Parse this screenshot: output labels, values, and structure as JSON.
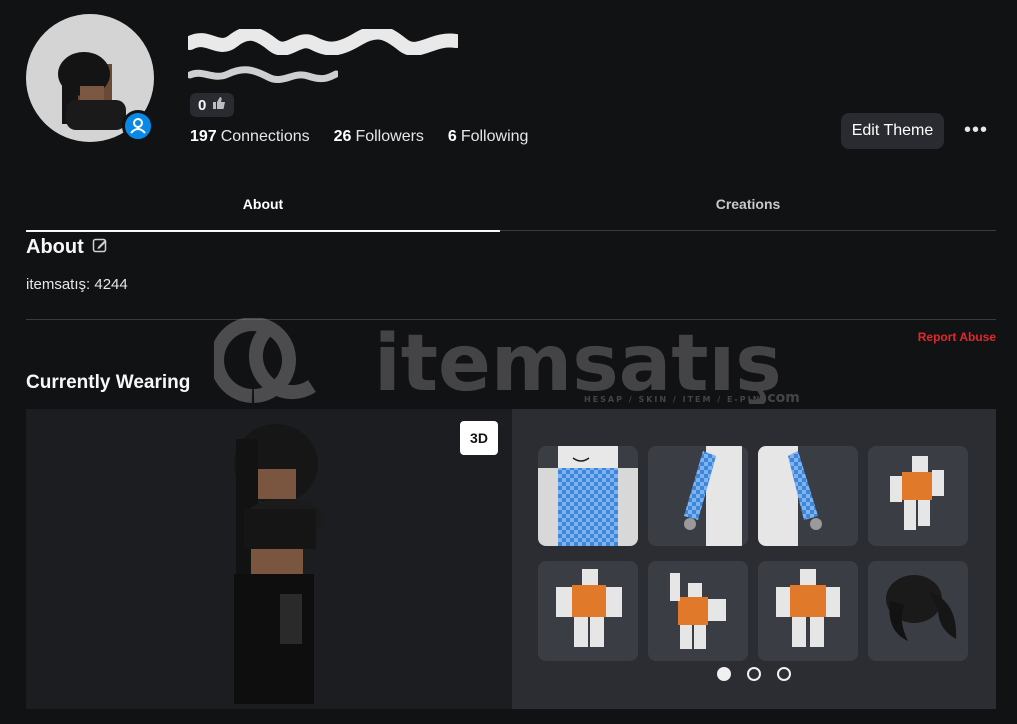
{
  "profile": {
    "likes": "0",
    "stats": [
      {
        "count": "197",
        "label": "Connections"
      },
      {
        "count": "26",
        "label": "Followers"
      },
      {
        "count": "6",
        "label": "Following"
      }
    ],
    "edit_theme_label": "Edit Theme",
    "more_label": "•••"
  },
  "tabs": [
    {
      "label": "About",
      "active": true
    },
    {
      "label": "Creations",
      "active": false
    }
  ],
  "about": {
    "title": "About",
    "text": "itemsatış: 4244",
    "report_label": "Report Abuse"
  },
  "wearing": {
    "title": "Currently Wearing",
    "view_toggle": "3D",
    "items": [
      {
        "icon": "shirt-checker-icon"
      },
      {
        "icon": "sleeves-left-icon"
      },
      {
        "icon": "sleeves-right-icon"
      },
      {
        "icon": "animation-run-icon"
      },
      {
        "icon": "animation-idle-icon"
      },
      {
        "icon": "animation-wave-icon"
      },
      {
        "icon": "animation-stand-icon"
      },
      {
        "icon": "hair-accessory-icon"
      }
    ],
    "pages": 3,
    "current_page": 1
  },
  "watermark": {
    "brand": "itemsatış",
    "tagline": "HESAP / SKIN / ITEM / E-PIN",
    "suffix": ".com"
  },
  "colors": {
    "background": "#111214",
    "accent_blue": "#0a88e6",
    "report_red": "#e0282d",
    "button_bg": "#2a2b30"
  }
}
